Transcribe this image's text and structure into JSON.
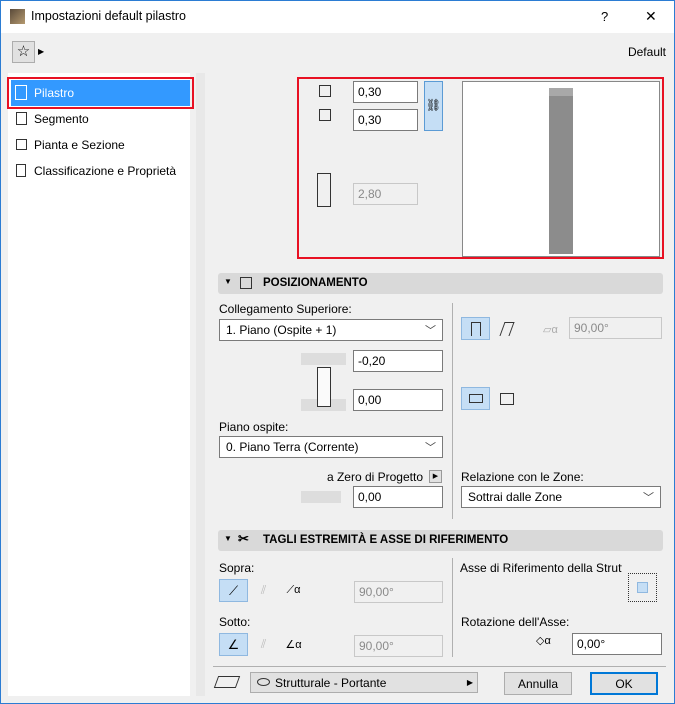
{
  "window": {
    "title": "Impostazioni default pilastro",
    "help": "?",
    "close": "✕"
  },
  "header": {
    "preset": "Default"
  },
  "sidebar": {
    "items": [
      {
        "label": "Pilastro"
      },
      {
        "label": "Segmento"
      },
      {
        "label": "Pianta e Sezione"
      },
      {
        "label": "Classificazione e Proprietà"
      }
    ]
  },
  "dimensions": {
    "width": "0,30",
    "depth": "0,30",
    "height": "2,80"
  },
  "positioning": {
    "title": "POSIZIONAMENTO",
    "top_link_label": "Collegamento Superiore:",
    "top_link_value": "1. Piano (Ospite + 1)",
    "top_offset": "-0,20",
    "bottom_offset": "0,00",
    "home_story_label": "Piano ospite:",
    "home_story_value": "0. Piano Terra (Corrente)",
    "ref_label": "a Zero di Progetto",
    "ref_value": "0,00",
    "angle": "90,00°",
    "zones_label": "Relazione con le Zone:",
    "zones_value": "Sottrai dalle Zone"
  },
  "cuts": {
    "title": "TAGLI ESTREMITÀ E ASSE DI RIFERIMENTO",
    "top_label": "Sopra:",
    "top_angle": "90,00°",
    "bottom_label": "Sotto:",
    "bottom_angle": "90,00°",
    "axis_label": "Asse di Riferimento della Struttu",
    "rotation_label": "Rotazione dell'Asse:",
    "rotation_value": "0,00°"
  },
  "footer": {
    "layer": "Strutturale - Portante",
    "cancel": "Annulla",
    "ok": "OK"
  }
}
